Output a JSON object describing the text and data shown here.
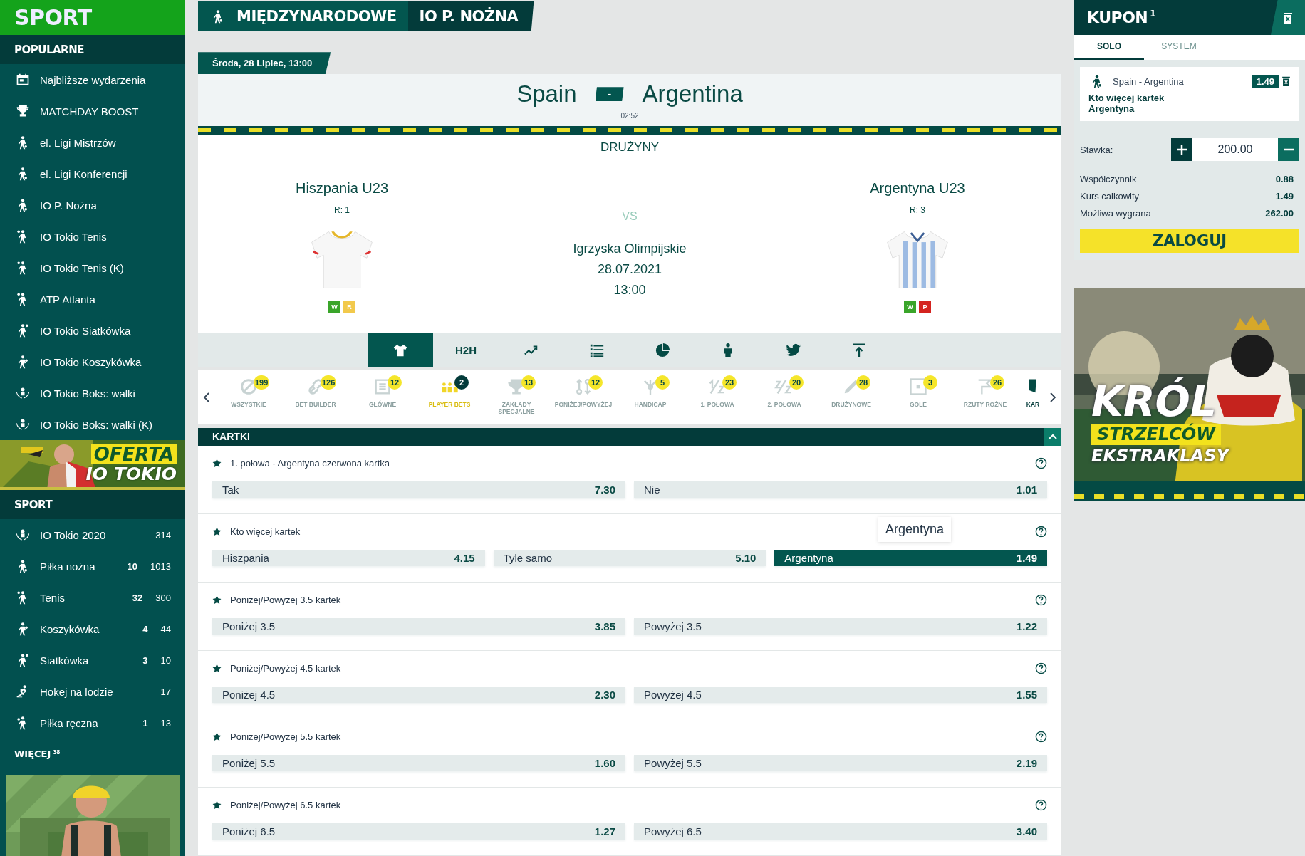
{
  "sidebar": {
    "logo": "SPORT",
    "popular_heading": "POPULARNE",
    "popular": [
      {
        "label": "Najbliższe wydarzenia",
        "kind": "calendar"
      },
      {
        "label": "MATCHDAY BOOST",
        "kind": "trophy"
      },
      {
        "label": "el. Ligi Mistrzów",
        "kind": "football"
      },
      {
        "label": "el. Ligi Konferencji",
        "kind": "football"
      },
      {
        "label": "IO P. Nożna",
        "kind": "football"
      },
      {
        "label": "IO Tokio Tenis",
        "kind": "tennis"
      },
      {
        "label": "IO Tokio Tenis (K)",
        "kind": "tennis"
      },
      {
        "label": "ATP Atlanta",
        "kind": "tennis"
      },
      {
        "label": "IO Tokio Siatkówka",
        "kind": "volleyball"
      },
      {
        "label": "IO Tokio Koszykówka",
        "kind": "basketball"
      },
      {
        "label": "IO Tokio Boks: walki",
        "kind": "olympics"
      },
      {
        "label": "IO Tokio Boks: walki (K)",
        "kind": "olympics"
      }
    ],
    "promo_banner": {
      "kind": "picture",
      "line_1": "OFERTA",
      "line_2": "IO TOKIO"
    },
    "sport_heading": "SPORT",
    "sports": [
      {
        "label": "IO Tokio 2020",
        "kind": "olympics",
        "count": "314"
      },
      {
        "label": "Piłka nożna",
        "kind": "football",
        "live": "10",
        "count": "1013"
      },
      {
        "label": "Tenis",
        "kind": "tennis",
        "live": "32",
        "count": "300"
      },
      {
        "label": "Koszykówka",
        "kind": "basketball",
        "live": "4",
        "count": "44"
      },
      {
        "label": "Siatkówka",
        "kind": "volleyball",
        "live": "3",
        "count": "10"
      },
      {
        "label": "Hokej na lodzie",
        "kind": "hockey",
        "count": "17"
      },
      {
        "label": "Piłka ręczna",
        "kind": "handball",
        "live": "1",
        "count": "13"
      }
    ],
    "more": {
      "label": "WIĘCEJ",
      "count": "38"
    }
  },
  "breadcrumb": [
    {
      "label": "MIĘDZYNARODOWE"
    },
    {
      "label": "IO P. NOŻNA"
    }
  ],
  "match": {
    "date": "Środa, 28 Lipiec, 13:00",
    "home": "Spain",
    "score": "-",
    "away": "Argentina",
    "clock": "02:52"
  },
  "teams": {
    "heading": "DRUŻYNY",
    "home": {
      "name": "Hiszpania U23",
      "rank": "R: 1",
      "kind": "plain",
      "form": [
        {
          "label": "W",
          "color": "#3aa52a"
        },
        {
          "label": "R",
          "color": "#f2c94c"
        }
      ]
    },
    "away": {
      "name": "Argentyna U23",
      "rank": "R: 3",
      "kind": "striped",
      "form": [
        {
          "label": "W",
          "color": "#3aa52a"
        },
        {
          "label": "P",
          "color": "#d4231f"
        }
      ]
    },
    "vs": "VS",
    "competition": "Igrzyska Olimpijskie",
    "date": "28.07.2021",
    "time": "13:00"
  },
  "view_tabs": [
    {
      "kind": "shirt",
      "selected": true
    },
    {
      "kind": "text",
      "label": "H2H",
      "selected": false
    },
    {
      "kind": "trend",
      "selected": false
    },
    {
      "kind": "list",
      "selected": false
    },
    {
      "kind": "pie",
      "selected": false
    },
    {
      "kind": "person",
      "selected": false
    },
    {
      "kind": "bird",
      "selected": false
    },
    {
      "kind": "top",
      "selected": false
    }
  ],
  "market_filters": [
    {
      "label": "WSZYSTKIE",
      "count": "199",
      "kind": "all",
      "selected": false
    },
    {
      "label": "BET BUILDER",
      "count": "126",
      "kind": "link",
      "selected": false
    },
    {
      "label": "GŁÓWNE",
      "count": "12",
      "kind": "list",
      "selected": false
    },
    {
      "label": "PLAYER BETS",
      "count": "2",
      "kind": "players",
      "selected": true
    },
    {
      "label": "ZAKŁADY SPECJALNE",
      "count": "13",
      "kind": "trophy",
      "selected": false
    },
    {
      "label": "PONIŻEJ/POWYŻEJ",
      "count": "12",
      "kind": "overunder",
      "selected": false
    },
    {
      "label": "HANDICAP",
      "count": "5",
      "kind": "fork",
      "selected": false
    },
    {
      "label": "1. POŁOWA",
      "count": "23",
      "kind": "half1",
      "selected": false
    },
    {
      "label": "2. POŁOWA",
      "count": "20",
      "kind": "half2",
      "selected": false
    },
    {
      "label": "DRUŻYNOWE",
      "count": "28",
      "kind": "pencil",
      "selected": false
    },
    {
      "label": "GOLE",
      "count": "3",
      "kind": "goal",
      "selected": false
    },
    {
      "label": "RZUTY ROŻNE",
      "count": "26",
      "kind": "corner",
      "selected": false
    },
    {
      "label": "KAR",
      "kind": "card",
      "selected": false
    }
  ],
  "section": {
    "title": "KARTKI",
    "expanded": true
  },
  "markets": [
    {
      "title": "1. połowa - Argentyna czerwona kartka",
      "outcomes": [
        {
          "label": "Tak",
          "odds": "7.30",
          "selected": false
        },
        {
          "label": "Nie",
          "odds": "1.01",
          "selected": false
        }
      ]
    },
    {
      "title": "Kto więcej kartek",
      "tooltip": "Argentyna",
      "outcomes": [
        {
          "label": "Hiszpania",
          "odds": "4.15",
          "selected": false
        },
        {
          "label": "Tyle samo",
          "odds": "5.10",
          "selected": false
        },
        {
          "label": "Argentyna",
          "odds": "1.49",
          "selected": true
        }
      ]
    },
    {
      "title": "Poniżej/Powyżej 3.5 kartek",
      "outcomes": [
        {
          "label": "Poniżej 3.5",
          "odds": "3.85",
          "selected": false
        },
        {
          "label": "Powyżej 3.5",
          "odds": "1.22",
          "selected": false
        }
      ]
    },
    {
      "title": "Poniżej/Powyżej 4.5 kartek",
      "outcomes": [
        {
          "label": "Poniżej 4.5",
          "odds": "2.30",
          "selected": false
        },
        {
          "label": "Powyżej 4.5",
          "odds": "1.55",
          "selected": false
        }
      ]
    },
    {
      "title": "Poniżej/Powyżej 5.5 kartek",
      "outcomes": [
        {
          "label": "Poniżej 5.5",
          "odds": "1.60",
          "selected": false
        },
        {
          "label": "Powyżej 5.5",
          "odds": "2.19",
          "selected": false
        }
      ]
    },
    {
      "title": "Poniżej/Powyżej 6.5 kartek",
      "outcomes": [
        {
          "label": "Poniżej 6.5",
          "odds": "1.27",
          "selected": false
        },
        {
          "label": "Powyżej 6.5",
          "odds": "3.40",
          "selected": false
        }
      ]
    }
  ],
  "coupon": {
    "title": "KUPON",
    "count": "1",
    "tabs": [
      {
        "label": "SOLO",
        "selected": true
      },
      {
        "label": "SYSTEM",
        "selected": false
      }
    ],
    "bet": {
      "event": "Spain - Argentina",
      "odds": "1.49",
      "market": "Kto więcej kartek",
      "pick": "Argentyna"
    },
    "stake_label": "Stawka:",
    "stake": "200.00",
    "stats": [
      {
        "label": "Współczynnik",
        "value": "0.88"
      },
      {
        "label": "Kurs całkowity",
        "value": "1.49"
      },
      {
        "label": "Możliwa wygrana",
        "value": "262.00"
      }
    ],
    "login": "ZALOGUJ"
  },
  "promo": {
    "kind": "picture",
    "line_1": "KRÓL",
    "line_2": "STRZELCÓW",
    "line_3": "EKSTRAKLASY"
  }
}
